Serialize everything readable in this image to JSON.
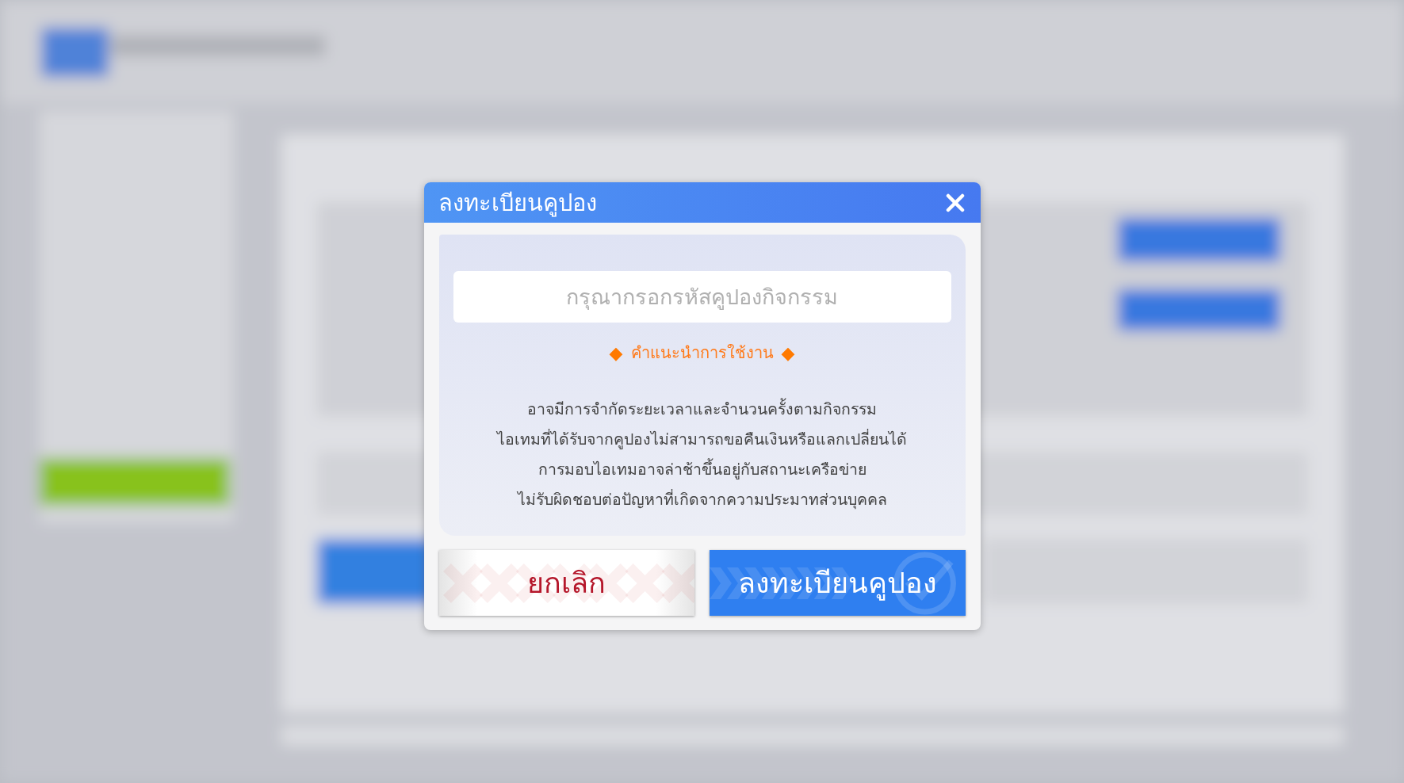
{
  "dialog": {
    "title": "ลงทะเบียนคูปอง",
    "coupon_field": {
      "placeholder": "กรุณากรอกรหัสคูปองกิจกรรม"
    },
    "guide": {
      "marker": "◆",
      "heading": "คำแนะนำการใช้งาน"
    },
    "notes": [
      "อาจมีการจำกัดระยะเวลาและจำนวนครั้งตามกิจกรรม",
      "ไอเทมที่ได้รับจากคูปองไม่สามารถขอคืนเงินหรือแลกเปลี่ยนได้",
      "การมอบไอเทมอาจล่าช้าขึ้นอยู่กับสถานะเครือข่าย",
      "ไม่รับผิดชอบต่อปัญหาที่เกิดจากความประมาทส่วนบุคคล"
    ],
    "buttons": [
      {
        "kind": "cancel",
        "label": "ยกเลิก"
      },
      {
        "kind": "confirm",
        "label": "ลงทะเบียนคูปอง"
      }
    ]
  }
}
